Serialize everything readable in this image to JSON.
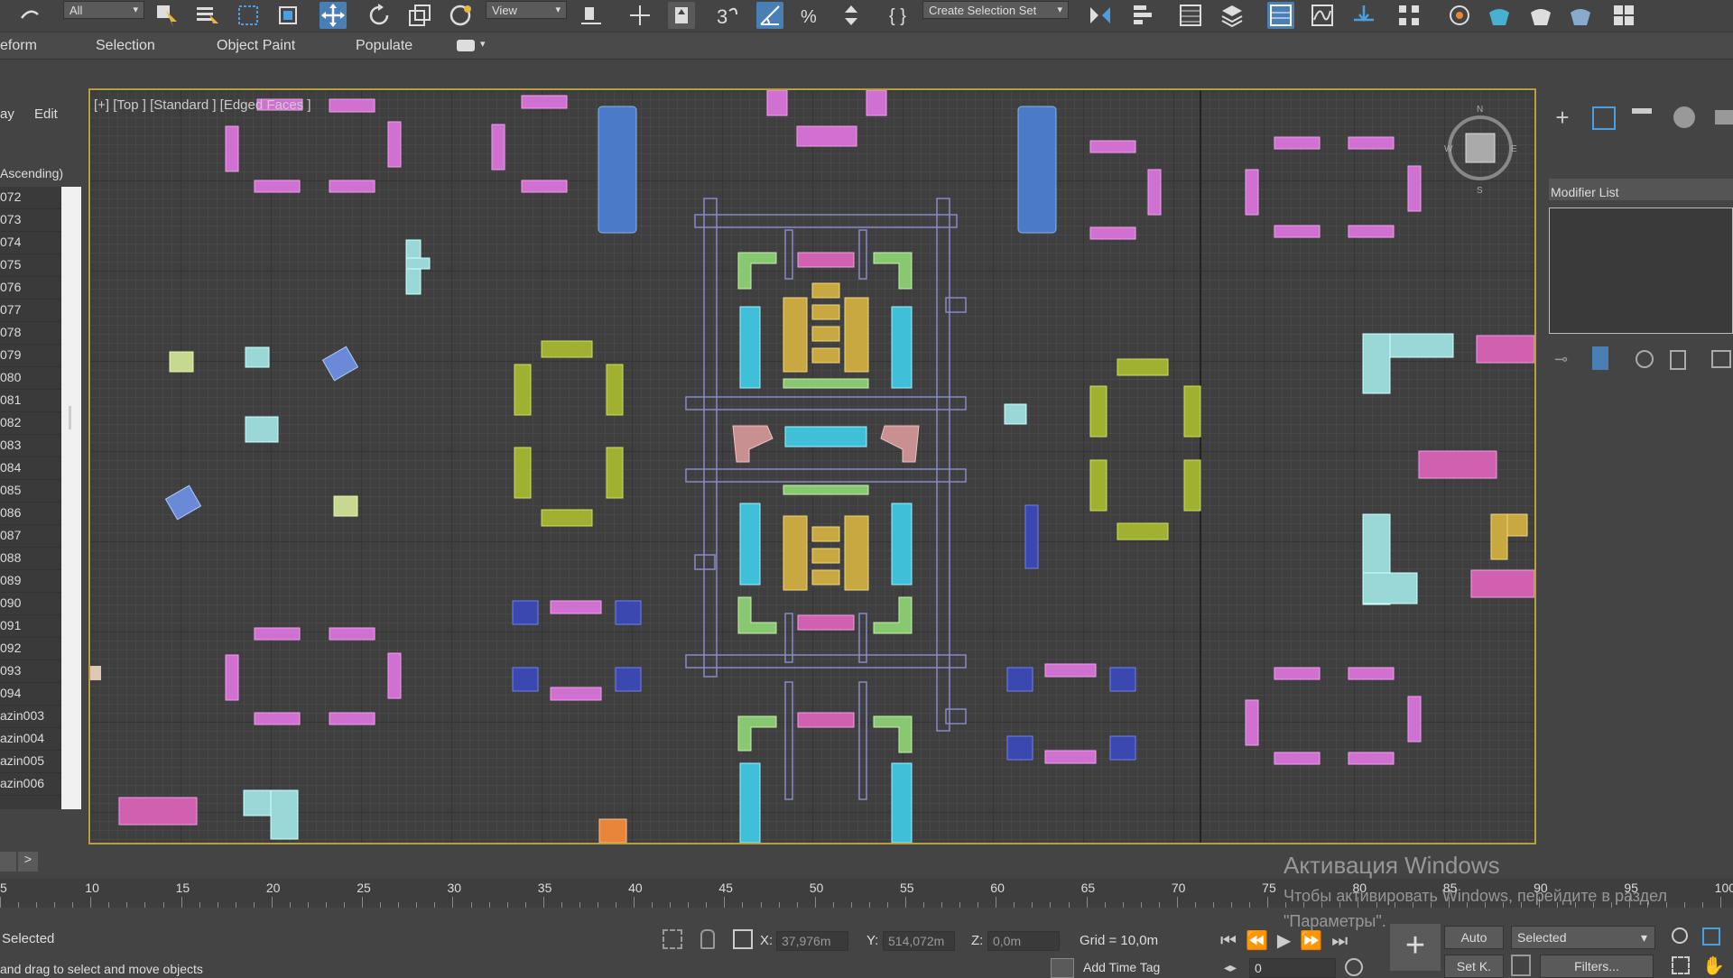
{
  "toolbar": {
    "filter": "All",
    "coordsys": "View",
    "selection_set": "Create Selection Set"
  },
  "ribbon": {
    "tabs": [
      "eform",
      "Selection",
      "Object Paint",
      "Populate"
    ]
  },
  "scene_explorer": {
    "menu": [
      "ay",
      "Edit"
    ],
    "sort": "Ascending)",
    "rows": [
      "072",
      "073",
      "074",
      "075",
      "076",
      "077",
      "078",
      "079",
      "080",
      "081",
      "082",
      "083",
      "084",
      "085",
      "086",
      "087",
      "088",
      "089",
      "090",
      "091",
      "092",
      "093",
      "094",
      "azin003",
      "azin004",
      "azin005",
      "azin006"
    ]
  },
  "viewport": {
    "label": "[+] [Top ] [Standard ] [Edged Faces ]"
  },
  "command_panel": {
    "modifier_list": "Modifier List"
  },
  "timeline": {
    "ticks": [
      "5",
      "10",
      "15",
      "20",
      "25",
      "30",
      "35",
      "40",
      "45",
      "50",
      "55",
      "60",
      "65",
      "70",
      "75",
      "80",
      "85",
      "90",
      "95",
      "100"
    ]
  },
  "status": {
    "selected": "Selected",
    "prompt": "and drag to select and move objects",
    "x_label": "X:",
    "x_value": "37,976m",
    "y_label": "Y:",
    "y_value": "514,072m",
    "z_label": "Z:",
    "z_value": "0,0m",
    "grid": "Grid = 10,0m",
    "add_time_tag": "Add Time Tag",
    "auto": "Auto",
    "setk": "Set K.",
    "key_filter": "Selected",
    "filters": "Filters...",
    "frame": "0"
  },
  "activation": {
    "title": "Активация Windows",
    "line1": "Чтобы активировать Windows, перейдите в раздел",
    "line2": "\"Параметры\"."
  },
  "colors": {
    "accent": "#4a7fb5",
    "viewport_border": "#b8a040"
  }
}
